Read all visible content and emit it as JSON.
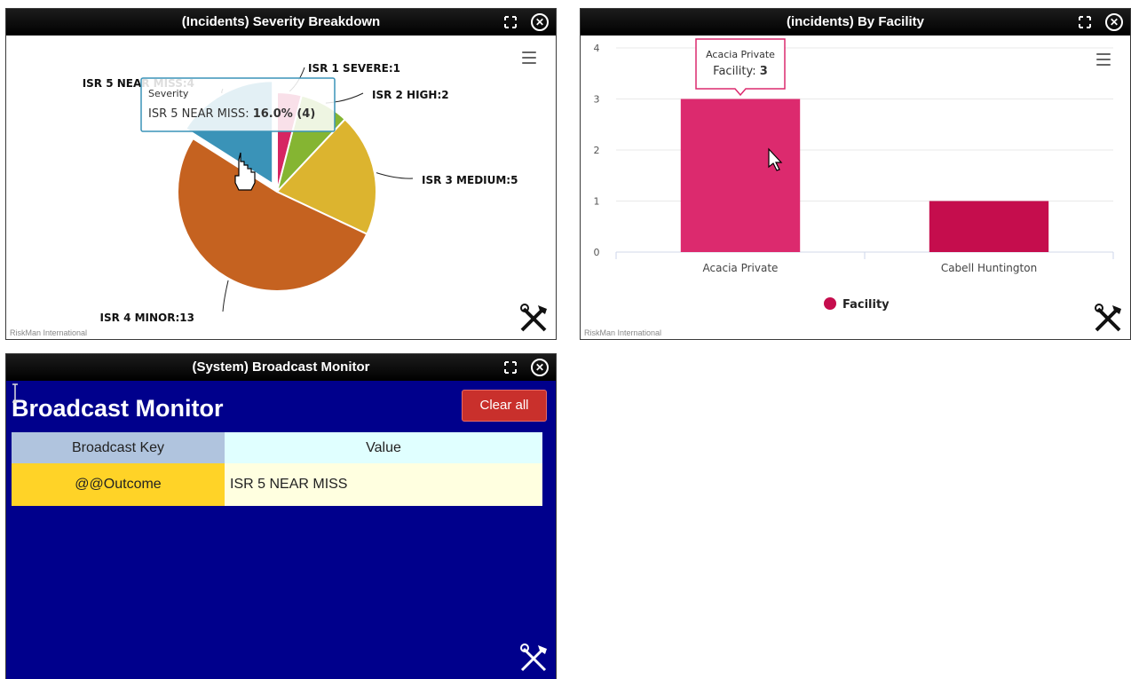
{
  "widgets": {
    "severity": {
      "title": "(Incidents) Severity Breakdown",
      "credit": "RiskMan International",
      "tooltip": {
        "header": "Severity",
        "label": "ISR 5 NEAR MISS:",
        "value": "16.0% (4)"
      }
    },
    "facility": {
      "title": "(incidents) By Facility",
      "credit": "RiskMan International",
      "tooltip": {
        "line1": "Acacia Private",
        "line2_label": "Facility:",
        "line2_value": "3"
      }
    },
    "broadcast": {
      "title": "(System) Broadcast Monitor",
      "heading": "Broadcast Monitor",
      "clear_label": "Clear all",
      "columns": [
        "Broadcast Key",
        "Value"
      ],
      "rows": [
        {
          "key": "@@Outcome",
          "value": "ISR 5 NEAR MISS"
        }
      ]
    }
  },
  "icons": {
    "expand": "expand-icon",
    "close": "close-icon",
    "menu": "hamburger-menu-icon",
    "tools": "tools-icon"
  },
  "chart_data": [
    {
      "type": "pie",
      "title": "",
      "labels": [
        "ISR 1 SEVERE",
        "ISR 2 HIGH",
        "ISR 3 MEDIUM",
        "ISR 4 MINOR",
        "ISR 5 NEAR MISS"
      ],
      "values": [
        1,
        2,
        5,
        13,
        4
      ],
      "data_labels": [
        "ISR 1 SEVERE:1",
        "ISR 2 HIGH:2",
        "ISR 3 MEDIUM:5",
        "ISR 4 MINOR:13",
        "ISR 5 NEAR MISS:4"
      ],
      "colors": [
        "#d62562",
        "#85b532",
        "#dcb42f",
        "#c56220",
        "#3a93b8"
      ],
      "highlighted": "ISR 5 NEAR MISS"
    },
    {
      "type": "bar",
      "title": "",
      "categories": [
        "Acacia Private",
        "Cabell Huntington"
      ],
      "series": [
        {
          "name": "Facility",
          "values": [
            3,
            1
          ]
        }
      ],
      "ylim": [
        0,
        4
      ],
      "yticks": [
        "0",
        "1",
        "2",
        "3",
        "4"
      ],
      "colors": [
        "#dc2a6e",
        "#c50d4d"
      ],
      "legend": "bottom",
      "grid": true
    }
  ]
}
